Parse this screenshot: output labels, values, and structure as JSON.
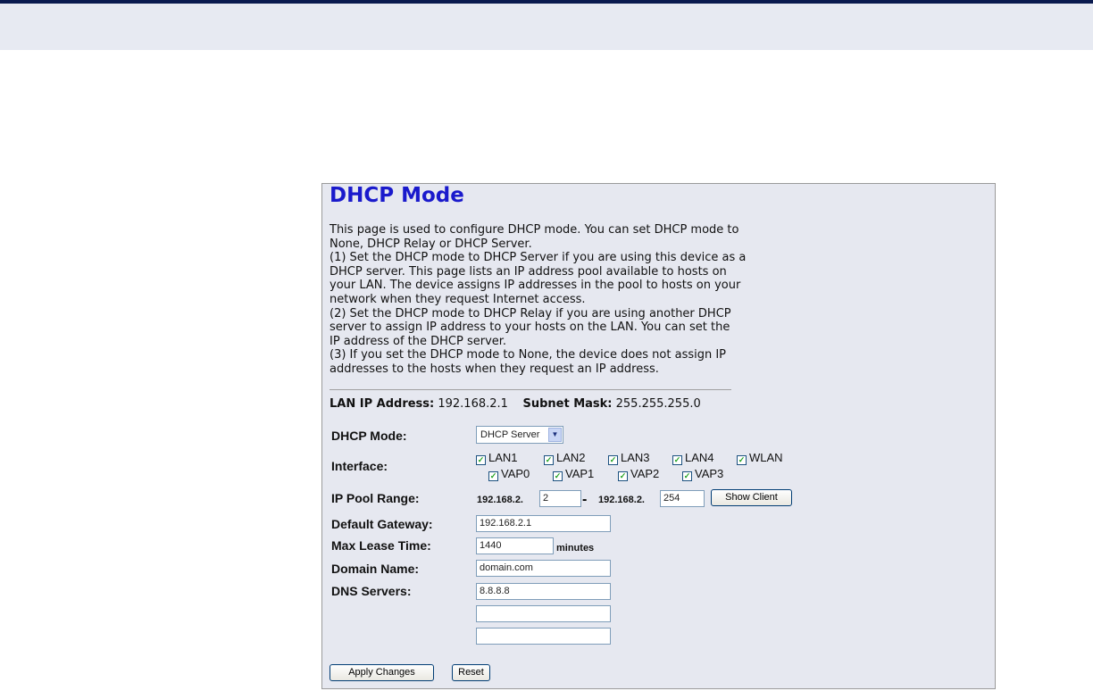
{
  "page": {
    "title": "DHCP Mode",
    "description_lines": [
      "This page is used to configure DHCP mode. You can set DHCP mode to",
      "None, DHCP Relay or DHCP Server.",
      "(1) Set the DHCP mode to DHCP Server if you are using this device as a",
      "DHCP server. This page lists an IP address pool available to hosts on",
      "your LAN. The device assigns IP addresses in the pool to hosts on your",
      "network when they request Internet access.",
      "(2) Set the DHCP mode to DHCP Relay if you are using another DHCP",
      "server to assign IP address to your hosts on the LAN. You can set the",
      "IP address of the DHCP server.",
      "(3) If you set the DHCP mode to None, the device does not assign IP",
      "addresses to the hosts when they request an IP address."
    ]
  },
  "lan": {
    "ip_label": "LAN IP Address:",
    "ip_value": "192.168.2.1",
    "mask_label": "Subnet Mask:",
    "mask_value": "255.255.255.0"
  },
  "form": {
    "dhcp_mode_label": "DHCP Mode:",
    "dhcp_mode_selected": "DHCP Server",
    "interface_label": "Interface:",
    "interfaces": [
      {
        "label": "LAN1",
        "checked": true
      },
      {
        "label": "LAN2",
        "checked": true
      },
      {
        "label": "LAN3",
        "checked": true
      },
      {
        "label": "LAN4",
        "checked": true
      },
      {
        "label": "WLAN",
        "checked": true
      },
      {
        "label": "VAP0",
        "checked": true
      },
      {
        "label": "VAP1",
        "checked": true
      },
      {
        "label": "VAP2",
        "checked": true
      },
      {
        "label": "VAP3",
        "checked": true
      }
    ],
    "pool_label": "IP Pool Range:",
    "pool_prefix_start": "192.168.2.",
    "pool_start": "2",
    "pool_separator": "-",
    "pool_prefix_end": "192.168.2.",
    "pool_end": "254",
    "show_client_label": "Show Client",
    "gateway_label": "Default Gateway:",
    "gateway_value": "192.168.2.1",
    "lease_label": "Max Lease Time:",
    "lease_value": "1440",
    "lease_unit": "minutes",
    "domain_label": "Domain Name:",
    "domain_value": "domain.com",
    "dns_label": "DNS Servers:",
    "dns_values": [
      "8.8.8.8",
      "",
      ""
    ]
  },
  "buttons": {
    "apply_label": "Apply Changes",
    "reset_label": "Reset"
  }
}
